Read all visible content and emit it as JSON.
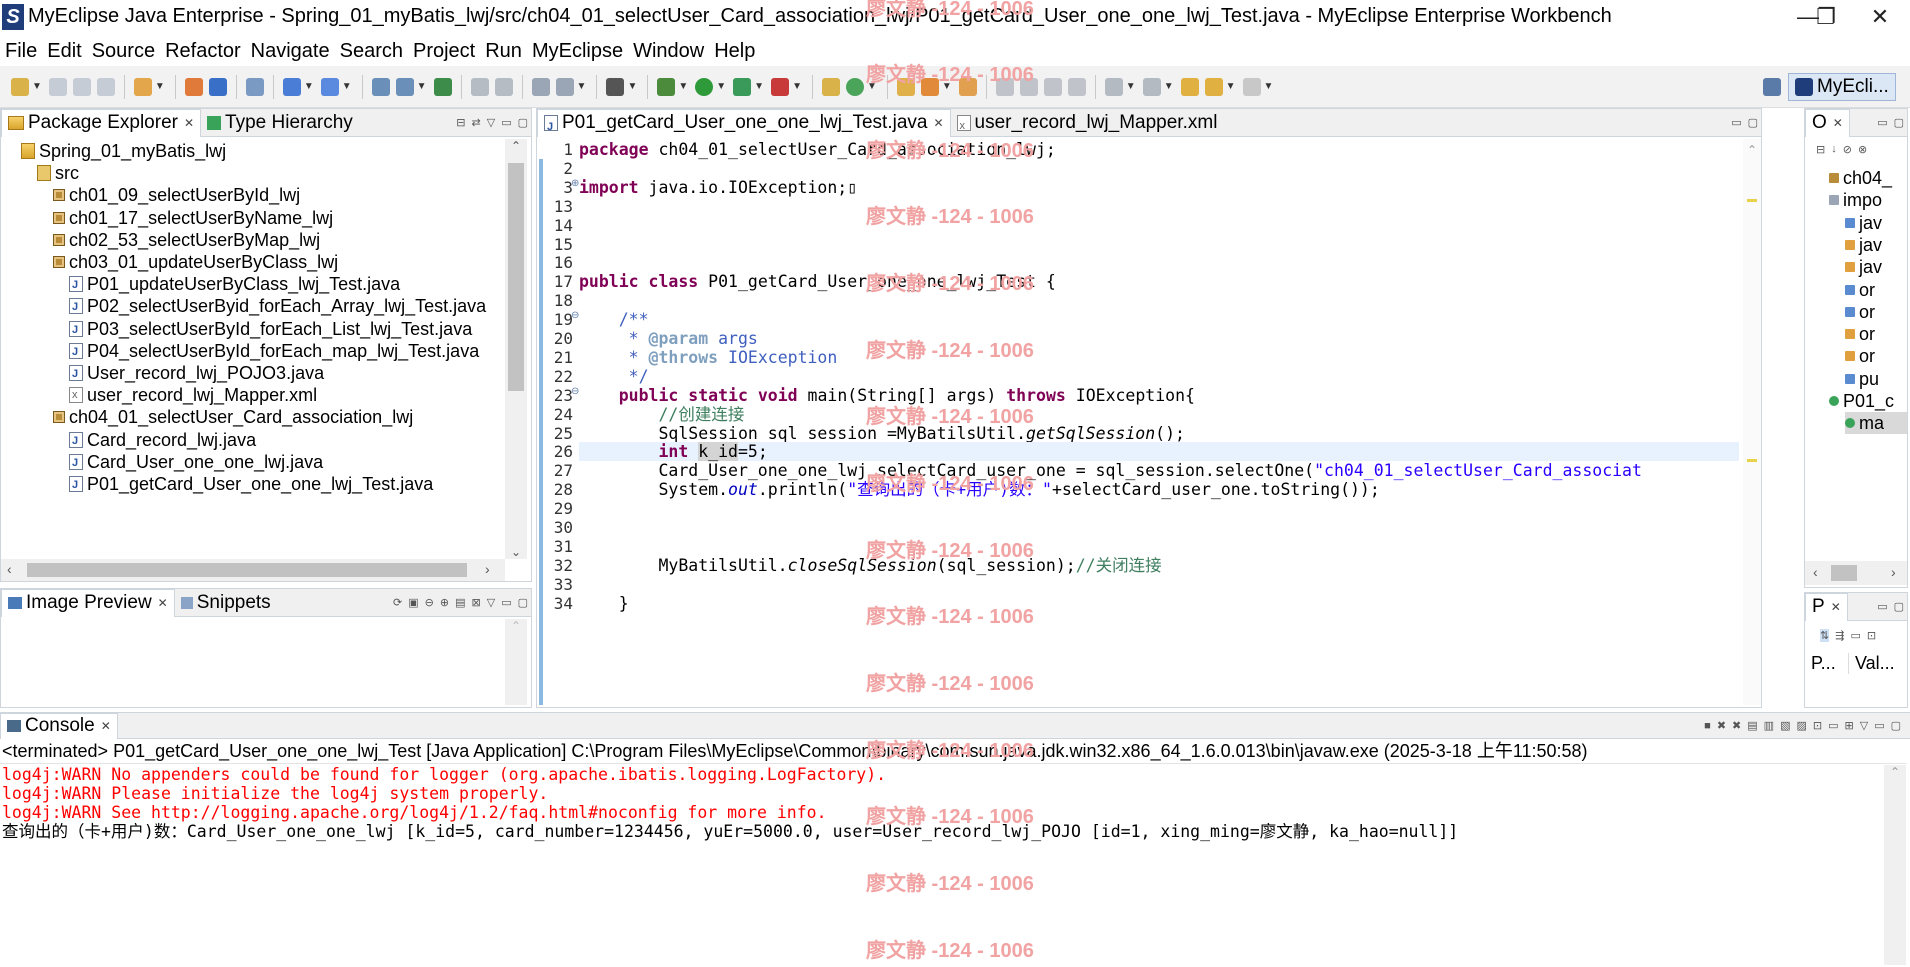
{
  "window": {
    "title": "MyEclipse Java Enterprise - Spring_01_myBatis_lwj/src/ch04_01_selectUser_Card_association_lwj/P01_getCard_User_one_one_lwj_Test.java - MyEclipse Enterprise Workbench",
    "minimize": "—",
    "maximize": "❐",
    "close": "✕",
    "logo_letter": "S"
  },
  "menu": [
    "File",
    "Edit",
    "Source",
    "Refactor",
    "Navigate",
    "Search",
    "Project",
    "Run",
    "MyEclipse",
    "Window",
    "Help"
  ],
  "perspective": {
    "label": "MyEcli..."
  },
  "package_explorer": {
    "tabs": [
      {
        "label": "Package Explorer"
      },
      {
        "label": "Type Hierarchy"
      }
    ],
    "tree": [
      {
        "label": "Spring_01_myBatis_lwj",
        "icon": "project-icon"
      },
      {
        "label": "src",
        "icon": "source-folder-icon"
      },
      {
        "label": "ch01_09_selectUserById_lwj",
        "icon": "package-icon"
      },
      {
        "label": "ch01_17_selectUserByName_lwj",
        "icon": "package-icon"
      },
      {
        "label": "ch02_53_selectUserByMap_lwj",
        "icon": "package-icon"
      },
      {
        "label": "ch03_01_updateUserByClass_lwj",
        "icon": "package-icon"
      },
      {
        "label": "P01_updateUserByClass_lwj_Test.java",
        "icon": "java-file-icon"
      },
      {
        "label": "P02_selectUserByid_forEach_Array_lwj_Test.java",
        "icon": "java-file-icon"
      },
      {
        "label": "P03_selectUserById_forEach_List_lwj_Test.java",
        "icon": "java-file-icon"
      },
      {
        "label": "P04_selectUserById_forEach_map_lwj_Test.java",
        "icon": "java-file-icon"
      },
      {
        "label": "User_record_lwj_POJO3.java",
        "icon": "java-file-icon"
      },
      {
        "label": "user_record_lwj_Mapper.xml",
        "icon": "xml-file-icon"
      },
      {
        "label": "ch04_01_selectUser_Card_association_lwj",
        "icon": "package-icon"
      },
      {
        "label": "Card_record_lwj.java",
        "icon": "java-file-icon"
      },
      {
        "label": "Card_User_one_one_lwj.java",
        "icon": "java-file-icon"
      },
      {
        "label": "P01_getCard_User_one_one_lwj_Test.java",
        "icon": "java-file-icon"
      }
    ]
  },
  "lower_left": {
    "tabs": [
      {
        "label": "Image Preview"
      },
      {
        "label": "Snippets"
      }
    ]
  },
  "editor": {
    "tabs": [
      {
        "label": "P01_getCard_User_one_one_lwj_Test.java"
      },
      {
        "label": "user_record_lwj_Mapper.xml"
      }
    ],
    "lines": [
      {
        "n": "1",
        "html": "<span class='kw'>package</span> ch04_01_selectUser_Card_association_lwj;"
      },
      {
        "n": "2",
        "html": ""
      },
      {
        "n": "3",
        "html": "<span class='kw'>import</span> java.io.IOException;▯"
      },
      {
        "n": "13",
        "html": ""
      },
      {
        "n": "14",
        "html": ""
      },
      {
        "n": "15",
        "html": ""
      },
      {
        "n": "16",
        "html": ""
      },
      {
        "n": "17",
        "html": "<span class='kw'>public</span> <span class='kw'>class</span> P01_getCard_User_one_one_lwj_Test {"
      },
      {
        "n": "18",
        "html": ""
      },
      {
        "n": "19",
        "html": "    <span class='jd'>/**</span>"
      },
      {
        "n": "20",
        "html": "<span class='jd'>     * <span class='tag'>@param</span> args</span>"
      },
      {
        "n": "21",
        "html": "<span class='jd'>     * <span class='tag'>@throws</span> IOException</span>"
      },
      {
        "n": "22",
        "html": "<span class='jd'>     */</span>"
      },
      {
        "n": "23",
        "html": "    <span class='kw'>public</span> <span class='kw'>static</span> <span class='kw'>void</span> main(String[] args) <span class='kw'>throws</span> IOException{"
      },
      {
        "n": "24",
        "html": "        <span class='cm'>//创建连接</span>"
      },
      {
        "n": "25",
        "html": "        SqlSession sql_session =MyBatilsUtil.<span class='it'>getSqlSession</span>();"
      },
      {
        "n": "26",
        "html": "        <span class='kw'>int</span> <span class='hl'>k_id</span>=5;"
      },
      {
        "n": "27",
        "html": "        Card_User_one_one_lwj selectCard_user_one = sql_session.selectOne(<span class='str'>\"ch04_01_selectUser_Card_associat</span>"
      },
      {
        "n": "28",
        "html": "        System.<span class='fld'>out</span>.println(<span class='str'>\"查询出的（卡+用户)数：\"</span>+selectCard_user_one.toString());"
      },
      {
        "n": "29",
        "html": ""
      },
      {
        "n": "30",
        "html": ""
      },
      {
        "n": "31",
        "html": ""
      },
      {
        "n": "32",
        "html": "        MyBatilsUtil.<span class='it'>closeSqlSession</span>(sql_session);<span class='cm'>//关闭连接</span>"
      },
      {
        "n": "33",
        "html": ""
      },
      {
        "n": "34",
        "html": "    }"
      }
    ]
  },
  "outline": {
    "tab": "O",
    "items": [
      {
        "label": "ch04_"
      },
      {
        "label": "impo"
      },
      {
        "label": "jav"
      },
      {
        "label": "jav"
      },
      {
        "label": "jav"
      },
      {
        "label": "or"
      },
      {
        "label": "or"
      },
      {
        "label": "or"
      },
      {
        "label": "or"
      },
      {
        "label": "pu"
      },
      {
        "label": "P01_c"
      },
      {
        "label": "ma"
      }
    ]
  },
  "properties": {
    "tab": "P",
    "col1": "P...",
    "col2": "Val..."
  },
  "console": {
    "tab": "Console",
    "header": "<terminated> P01_getCard_User_one_one_lwj_Test [Java Application] C:\\Program Files\\MyEclipse\\Common\\binary\\com.sun.java.jdk.win32.x86_64_1.6.0.013\\bin\\javaw.exe (2025-3-18 上午11:50:58)",
    "lines": [
      {
        "cls": "err",
        "text": "log4j:WARN No appenders could be found for logger (org.apache.ibatis.logging.LogFactory)."
      },
      {
        "cls": "err",
        "text": "log4j:WARN Please initialize the log4j system properly."
      },
      {
        "cls": "err",
        "text": "log4j:WARN See http://logging.apache.org/log4j/1.2/faq.html#noconfig for more info."
      },
      {
        "cls": "out",
        "text": "查询出的（卡+用户)数：Card_User_one_one_lwj [k_id=5, card_number=1234456, yuEr=5000.0, user=User_record_lwj_POJO [id=1, xing_ming=廖文静, ka_hao=null]]"
      }
    ]
  },
  "watermark": "廖文静 -124 - 1006",
  "colors": {
    "error": "#ff0000",
    "keyword": "#7f0055",
    "string": "#2a00ff",
    "comment": "#3f7f5f",
    "javadoc": "#3f5fbf"
  }
}
